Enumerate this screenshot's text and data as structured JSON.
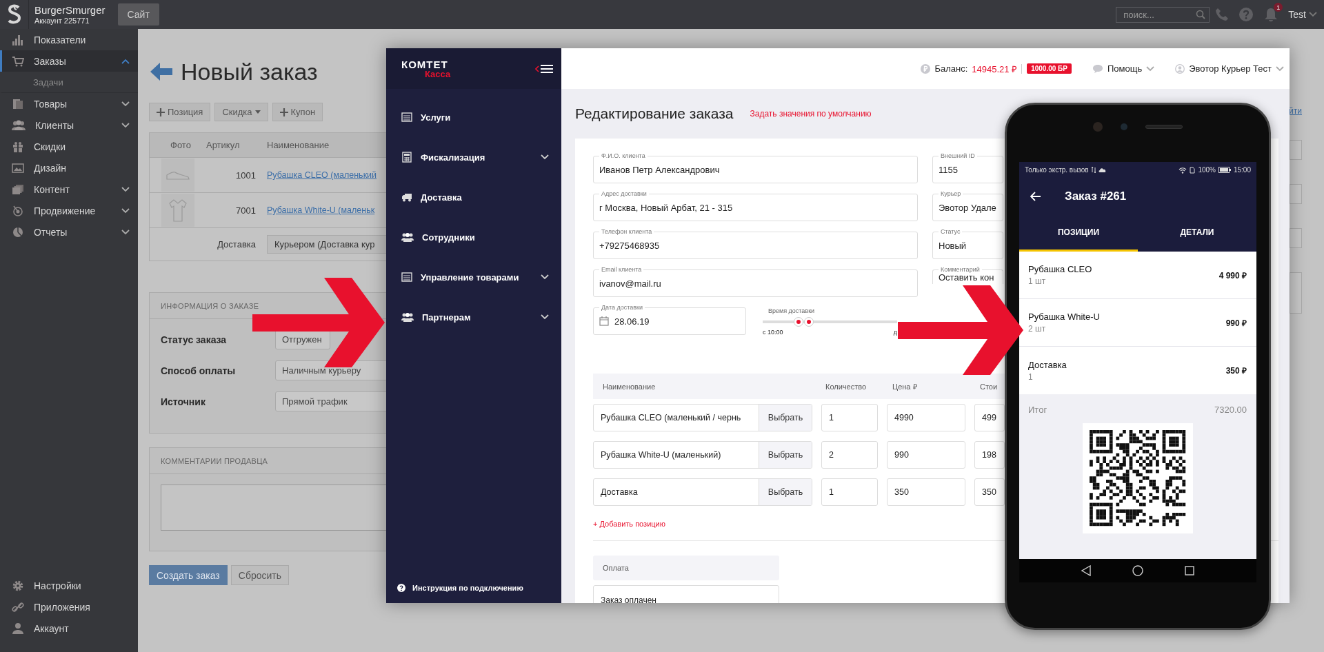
{
  "admin": {
    "brand": {
      "name": "BurgerSmurger",
      "account": "Аккаунт 225771"
    },
    "site_button": "Сайт",
    "search": {
      "placeholder": "поиск..."
    },
    "notifications": {
      "count": "1"
    },
    "user": "Test",
    "sidebar": {
      "items": [
        {
          "label": "Показатели",
          "selected": false
        },
        {
          "label": "Заказы",
          "selected": true,
          "expanded": true,
          "children": [
            {
              "label": "Задачи",
              "selected": false
            }
          ]
        },
        {
          "label": "Товары",
          "selected": false,
          "expanded": false
        },
        {
          "label": "Клиенты",
          "selected": false,
          "expanded": false
        },
        {
          "label": "Скидки",
          "selected": false
        },
        {
          "label": "Дизайн",
          "selected": false
        },
        {
          "label": "Контент",
          "selected": false,
          "expanded": false
        },
        {
          "label": "Продвижение",
          "selected": false,
          "expanded": false
        },
        {
          "label": "Отчеты",
          "selected": false,
          "expanded": false
        }
      ],
      "bottom_items": [
        {
          "label": "Настройки"
        },
        {
          "label": "Приложения"
        },
        {
          "label": "Аккаунт"
        }
      ]
    },
    "page": {
      "title": "Новый заказ",
      "toolbar": [
        {
          "label": "Позиция",
          "kind": "add"
        },
        {
          "label": "Скидка",
          "kind": "dropdown"
        },
        {
          "label": "Купон",
          "kind": "add"
        }
      ],
      "table": {
        "columns": [
          "Фото",
          "Артикул",
          "Наименование"
        ],
        "rows": [
          {
            "sku": "1001",
            "name": "Рубашка CLEO (маленький"
          },
          {
            "sku": "7001",
            "name": "Рубашка White-U (маленьк"
          }
        ],
        "delivery": {
          "label": "Доставка",
          "value": "Курьером (Доставка кур"
        }
      },
      "order_info": {
        "title": "ИНФОРМАЦИЯ О ЗАКАЗЕ",
        "fields": [
          {
            "label": "Статус заказа",
            "value": "Отгружен"
          },
          {
            "label": "Способ оплаты",
            "value": "Наличным курьеру"
          },
          {
            "label": "Источник",
            "value": "Прямой трафик"
          }
        ]
      },
      "comments": {
        "title": "КОММЕНТАРИИ ПРОДАВЦА"
      },
      "buttons": [
        {
          "label": "Создать заказ",
          "kind": "primary"
        },
        {
          "label": "Сбросить",
          "kind": "default"
        }
      ],
      "side_link": "йти"
    }
  },
  "komtet": {
    "logo": {
      "name": "КОМТЕТ",
      "product": "Касса"
    },
    "nav": [
      {
        "label": "Услуги"
      },
      {
        "label": "Фискализация",
        "expanded": false
      },
      {
        "label": "Доставка"
      },
      {
        "label": "Сотрудники"
      },
      {
        "label": "Управление товарами",
        "expanded": false
      },
      {
        "label": "Партнерам",
        "expanded": false
      }
    ],
    "help_link": "Инструкция по подключению",
    "header": {
      "balance_label": "Баланс:",
      "balance": "14945.21 ₽",
      "bonus": "1000.00 БР",
      "help": "Помощь",
      "user": "Эвотор Курьер Тест"
    },
    "title": "Редактирование заказа",
    "defaults_link": "Задать значения по умолчанию",
    "client_fields": [
      {
        "label": "Ф.И.О. клиента",
        "value": "Иванов Петр Александрович"
      },
      {
        "label": "Адрес доставки",
        "value": "г Москва, Новый Арбат, 21 - 315"
      },
      {
        "label": "Телефон клиента",
        "value": "+79275468935"
      },
      {
        "label": "Email клиента",
        "value": "ivanov@mail.ru"
      }
    ],
    "delivery_date": {
      "label": "Дата доставки",
      "value": "28.06.19"
    },
    "delivery_time": {
      "label": "Время доставки",
      "from": "с 10:00",
      "to": "д"
    },
    "order_fields": [
      {
        "label": "Внешний ID",
        "value": "1155"
      },
      {
        "label": "Курьер",
        "value": "Эвотор Удале"
      },
      {
        "label": "Статус",
        "value": "Новый"
      },
      {
        "label": "Комментарий",
        "value": "Оставить кон"
      }
    ],
    "items": {
      "columns": [
        "Наименование",
        "Количество",
        "Цена ₽",
        "Стои"
      ],
      "rows": [
        {
          "name": "Рубашка CLEO (маленький / чернь",
          "button": "Выбрать",
          "qty": "1",
          "price": "4990",
          "cost": "499"
        },
        {
          "name": "Рубашка White-U (маленький)",
          "button": "Выбрать",
          "qty": "2",
          "price": "990",
          "cost": "198"
        },
        {
          "name": "Доставка",
          "button": "Выбрать",
          "qty": "1",
          "price": "350",
          "cost": "350"
        }
      ]
    },
    "add_link": "+ Добавить позицию",
    "payment": {
      "label": "Оплата",
      "value": "Заказ оплачен"
    }
  },
  "phone": {
    "status": {
      "carrier": "Только экстр. вызов",
      "battery": "100%",
      "time": "15:00"
    },
    "title": "Заказ #261",
    "tabs": [
      {
        "label": "ПОЗИЦИИ",
        "selected": true
      },
      {
        "label": "ДЕТАЛИ",
        "selected": false
      }
    ],
    "items": [
      {
        "name": "Рубашка CLEO",
        "qty": "1 шт",
        "price": "4 990 ₽"
      },
      {
        "name": "Рубашка White-U",
        "qty": "2 шт",
        "price": "990 ₽"
      },
      {
        "name": "Доставка",
        "qty": "1",
        "price": "350 ₽"
      }
    ],
    "total": {
      "label": "Итог",
      "value": "7320.00"
    }
  }
}
